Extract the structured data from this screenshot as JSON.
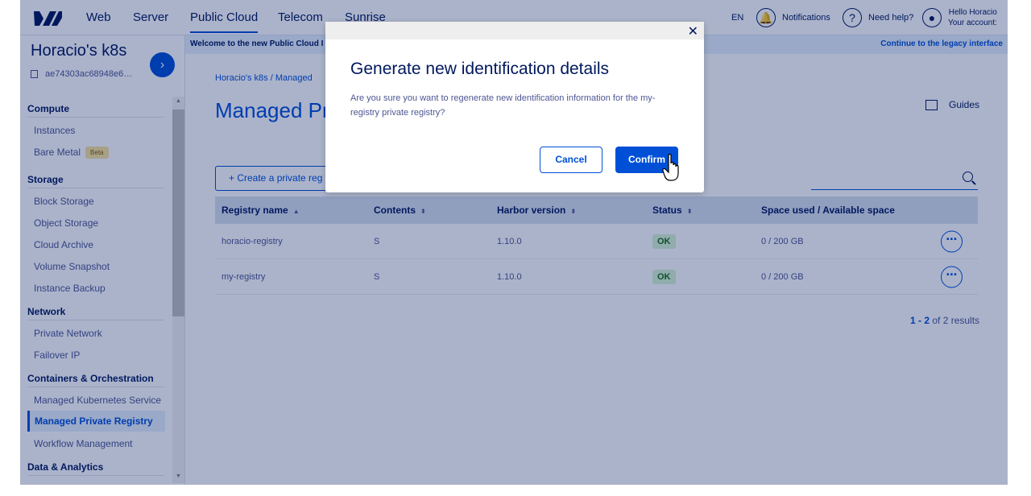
{
  "nav": {
    "tabs": [
      "Web",
      "Server",
      "Public Cloud",
      "Telecom",
      "Sunrise"
    ],
    "language": "EN",
    "notifications": "Notifications",
    "help": "Need help?",
    "account_hello": "Hello Horacio",
    "account_label": "Your account:"
  },
  "sidebar": {
    "project_title": "Horacio's k8s",
    "project_id": "ae74303ac68948e6…",
    "sections": {
      "compute": "Compute",
      "storage": "Storage",
      "network": "Network",
      "containers": "Containers & Orchestration",
      "data": "Data & Analytics"
    },
    "items": {
      "instances": "Instances",
      "bare_metal": "Bare Metal",
      "beta": "Beta",
      "block_storage": "Block Storage",
      "object_storage": "Object Storage",
      "cloud_archive": "Cloud Archive",
      "volume_snapshot": "Volume Snapshot",
      "instance_backup": "Instance Backup",
      "private_network": "Private Network",
      "failover_ip": "Failover IP",
      "kubernetes": "Managed Kubernetes Service",
      "registry": "Managed Private Registry",
      "workflow": "Workflow Management"
    }
  },
  "banner": {
    "left": "Welcome to the new Public Cloud I",
    "right": "Continue to the legacy interface"
  },
  "main": {
    "breadcrumb": "Horacio's k8s / Managed",
    "title": "Managed Pr",
    "guides": "Guides",
    "create_button": "+ Create a private reg",
    "results_range": "1 - 2",
    "results_total": "of 2 results"
  },
  "table": {
    "headers": {
      "name": "Registry name",
      "contents": "Contents",
      "harbor": "Harbor version",
      "status": "Status",
      "space": "Space used / Available space"
    },
    "rows": [
      {
        "name": "horacio-registry",
        "contents": "S",
        "harbor": "1.10.0",
        "status": "OK",
        "space": "0 / 200 GB"
      },
      {
        "name": "my-registry",
        "contents": "S",
        "harbor": "1.10.0",
        "status": "OK",
        "space": "0 / 200 GB"
      }
    ]
  },
  "modal": {
    "title": "Generate new identification details",
    "text": "Are you sure you want to regenerate new identification information for the my-registry private registry?",
    "cancel": "Cancel",
    "confirm": "Confirm"
  }
}
